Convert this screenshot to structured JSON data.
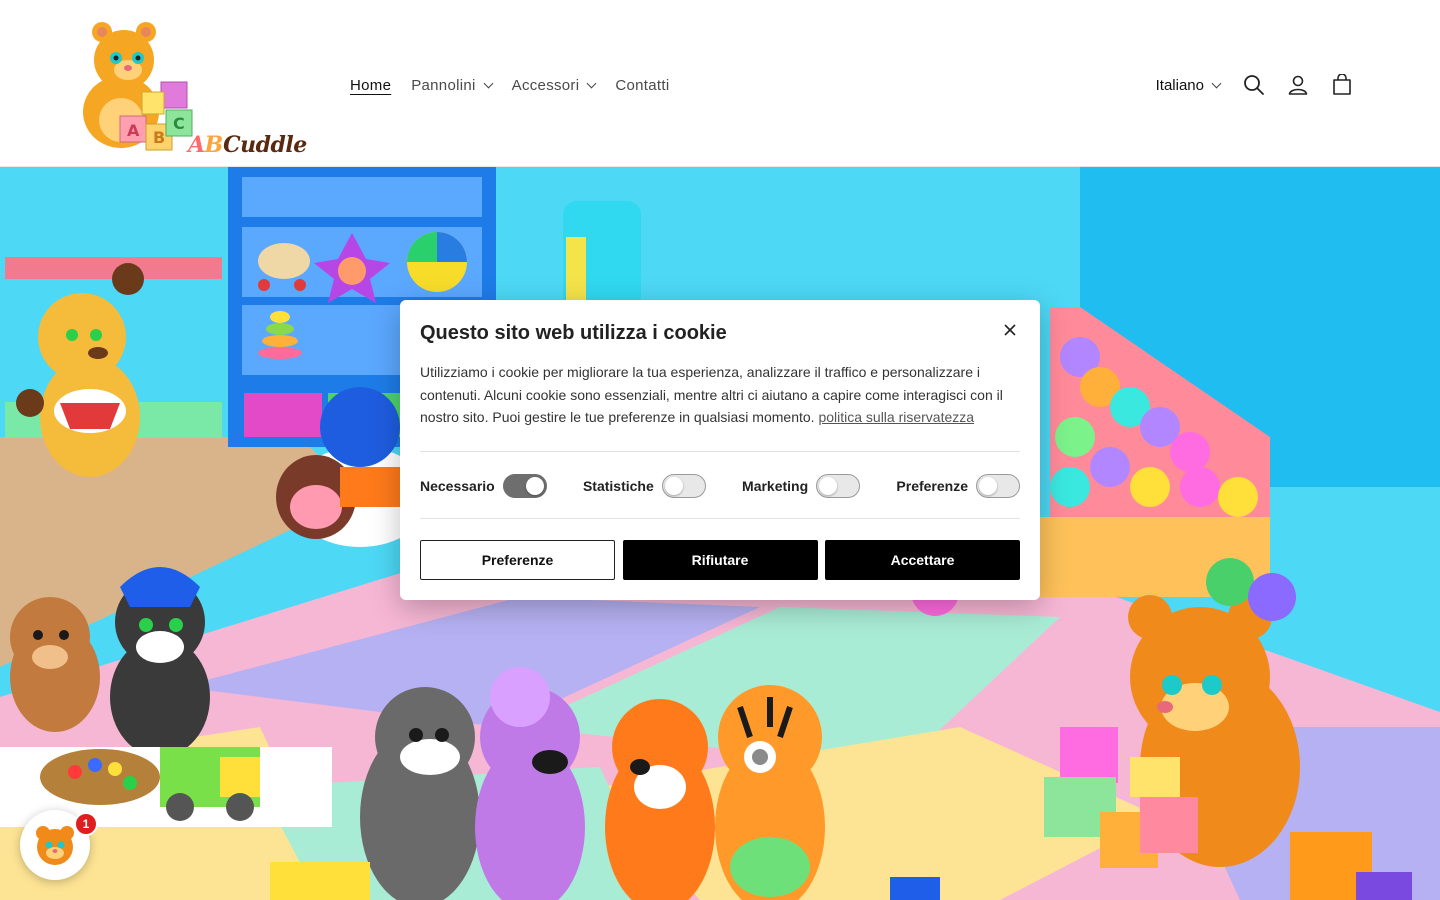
{
  "header": {
    "logo_text_a": "A",
    "logo_text_b": "B",
    "logo_text_rest": "Cuddle",
    "nav": [
      {
        "label": "Home",
        "active": true,
        "has_dropdown": false
      },
      {
        "label": "Pannolini",
        "active": false,
        "has_dropdown": true
      },
      {
        "label": "Accessori",
        "active": false,
        "has_dropdown": true
      },
      {
        "label": "Contatti",
        "active": false,
        "has_dropdown": false
      }
    ],
    "language": "Italiano",
    "icons": [
      "search-icon",
      "account-icon",
      "cart-icon"
    ]
  },
  "cookie_banner": {
    "title": "Questo sito web utilizza i cookie",
    "text": "Utilizziamo i cookie per migliorare la tua esperienza, analizzare il traffico e personalizzare i contenuti. Alcuni cookie sono essenziali, mentre altri ci aiutano a capire come interagisci con il nostro sito. Puoi gestire le tue preferenze in qualsiasi momento.",
    "privacy_link": "politica sulla riservatezza",
    "toggles": [
      {
        "label": "Necessario",
        "on": true
      },
      {
        "label": "Statistiche",
        "on": false
      },
      {
        "label": "Marketing",
        "on": false
      },
      {
        "label": "Preferenze",
        "on": false
      }
    ],
    "buttons": {
      "preferences": "Preferenze",
      "reject": "Rifiutare",
      "accept": "Accettare"
    }
  },
  "chat_widget": {
    "badge_count": "1"
  },
  "colors": {
    "wall": "#4dd8f5",
    "floor_wood": "#d9b48a",
    "toggle_on": "#6e6e6e",
    "badge": "#e01e1e"
  }
}
